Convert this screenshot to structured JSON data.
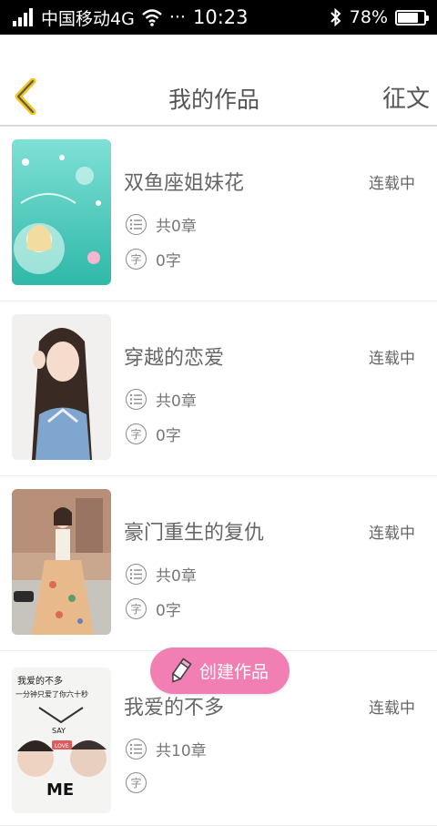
{
  "status_bar": {
    "carrier": "中国移动4G",
    "dots": "···",
    "time": "10:23",
    "battery": "78%",
    "battery_level": 0.78
  },
  "header": {
    "title": "我的作品",
    "action": "征文",
    "accent": "#f5c518"
  },
  "works": [
    {
      "title": "双鱼座姐妹花",
      "status": "连载中",
      "chapters": "共0章",
      "words": "0字"
    },
    {
      "title": "穿越的恋爱",
      "status": "连载中",
      "chapters": "共0章",
      "words": "0字"
    },
    {
      "title": "豪门重生的复仇",
      "status": "连载中",
      "chapters": "共0章",
      "words": "0字"
    },
    {
      "title": "我爱的不多",
      "status": "连载中",
      "chapters": "共10章",
      "words": ""
    }
  ],
  "icons": {
    "chapter": "list-icon",
    "words": "zi-character-icon",
    "fab": "pencil-icon"
  },
  "word_glyph": "字",
  "cover4_text": {
    "line1": "我爱的不多",
    "line2": "一分钟只爱了你六十秒",
    "say": "SAY",
    "love": "LOVE",
    "me": "ME"
  },
  "fab": {
    "label": "创建作品",
    "color": "#f27fb3"
  }
}
